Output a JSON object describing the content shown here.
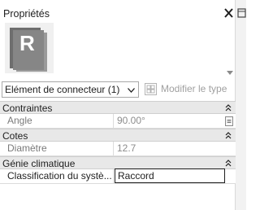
{
  "panel": {
    "title": "Propriétés",
    "close_icon": "close-icon"
  },
  "type_preview": {
    "thumbnail_icon": "revit-family-icon",
    "thumbnail_letter": "R",
    "dropdown_icon": "chevron-down-icon"
  },
  "selector": {
    "value": "Elément de connecteur (1)"
  },
  "edit_type": {
    "label": "Modifier le type",
    "enabled": false
  },
  "groups": [
    {
      "title": "Contraintes",
      "rows": [
        {
          "name": "Angle",
          "value": "90.00°",
          "editable": false,
          "has_button": true
        }
      ]
    },
    {
      "title": "Cotes",
      "rows": [
        {
          "name": "Diamètre",
          "value": "12.7",
          "editable": false,
          "has_button": false
        }
      ]
    },
    {
      "title": "Génie climatique",
      "rows": [
        {
          "name": "Classification du systè...",
          "value": "Raccord",
          "editable": true,
          "has_button": false
        }
      ]
    }
  ],
  "colors": {
    "group_header_bg": "#e8e8e8",
    "readonly_text": "#8c8c8c",
    "text": "#1e1e1e"
  }
}
